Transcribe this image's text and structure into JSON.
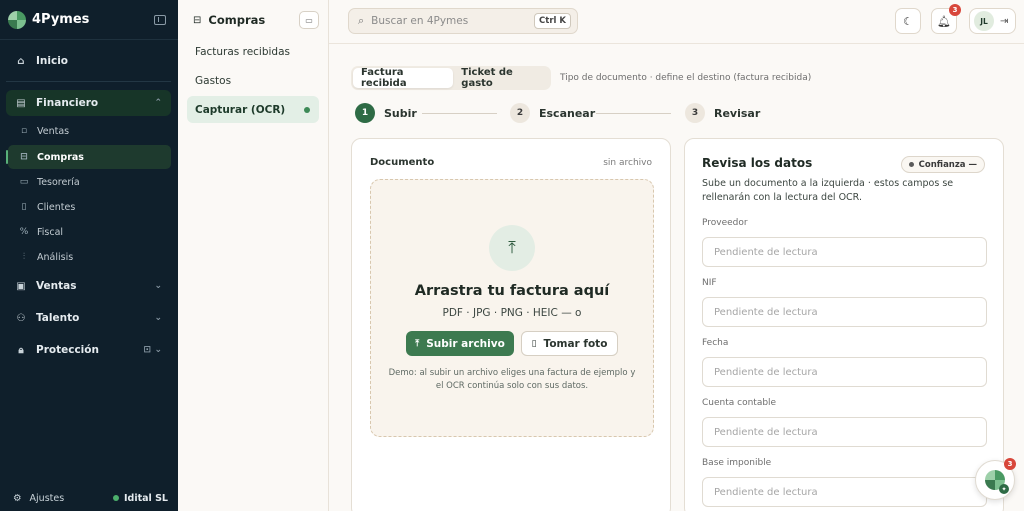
{
  "app": {
    "name": "4Pymes"
  },
  "sidebar": {
    "inicio": "Inicio",
    "financiero": "Financiero",
    "financiero_items": [
      "Ventas",
      "Compras",
      "Tesorería",
      "Clientes",
      "Fiscal",
      "Análisis"
    ],
    "ventas": "Ventas",
    "talento": "Talento",
    "proteccion": "Protección",
    "settings": "Ajustes",
    "org": "Idital SL"
  },
  "subpanel": {
    "title": "Compras",
    "links": [
      "Facturas recibidas",
      "Gastos",
      "Capturar (OCR)"
    ]
  },
  "topbar": {
    "search_placeholder": "Buscar en 4Pymes",
    "shortcut": "Ctrl K",
    "notifications": "3",
    "user_initials": "JL"
  },
  "doc_type": {
    "tabs": [
      "Factura recibida",
      "Ticket de gasto"
    ],
    "hint": "Tipo de documento · define el destino (factura recibida)"
  },
  "steps": [
    {
      "num": "1",
      "label": "Subir"
    },
    {
      "num": "2",
      "label": "Escanear"
    },
    {
      "num": "3",
      "label": "Revisar"
    }
  ],
  "document": {
    "label": "Documento",
    "status": "sin archivo",
    "dropzone_title": "Arrastra tu factura aquí",
    "formats": "PDF · JPG · PNG · HEIC — o",
    "upload_button": "Subir archivo",
    "photo_button": "Tomar foto",
    "note": "Demo: al subir un archivo eliges una factura de ejemplo y el OCR continúa solo con sus datos."
  },
  "review": {
    "title": "Revisa los datos",
    "confidence": "Confianza —",
    "description": "Sube un documento a la izquierda · estos campos se rellenarán con la lectura del OCR.",
    "placeholder": "Pendiente de lectura",
    "fields": [
      "Proveedor",
      "NIF",
      "Fecha",
      "Cuenta contable",
      "Base imponible"
    ]
  },
  "fab": {
    "badge": "3"
  },
  "colors": {
    "sidebar_bg": "#0f1f2b",
    "accent": "#3d7a50",
    "badge": "#d8473b"
  }
}
